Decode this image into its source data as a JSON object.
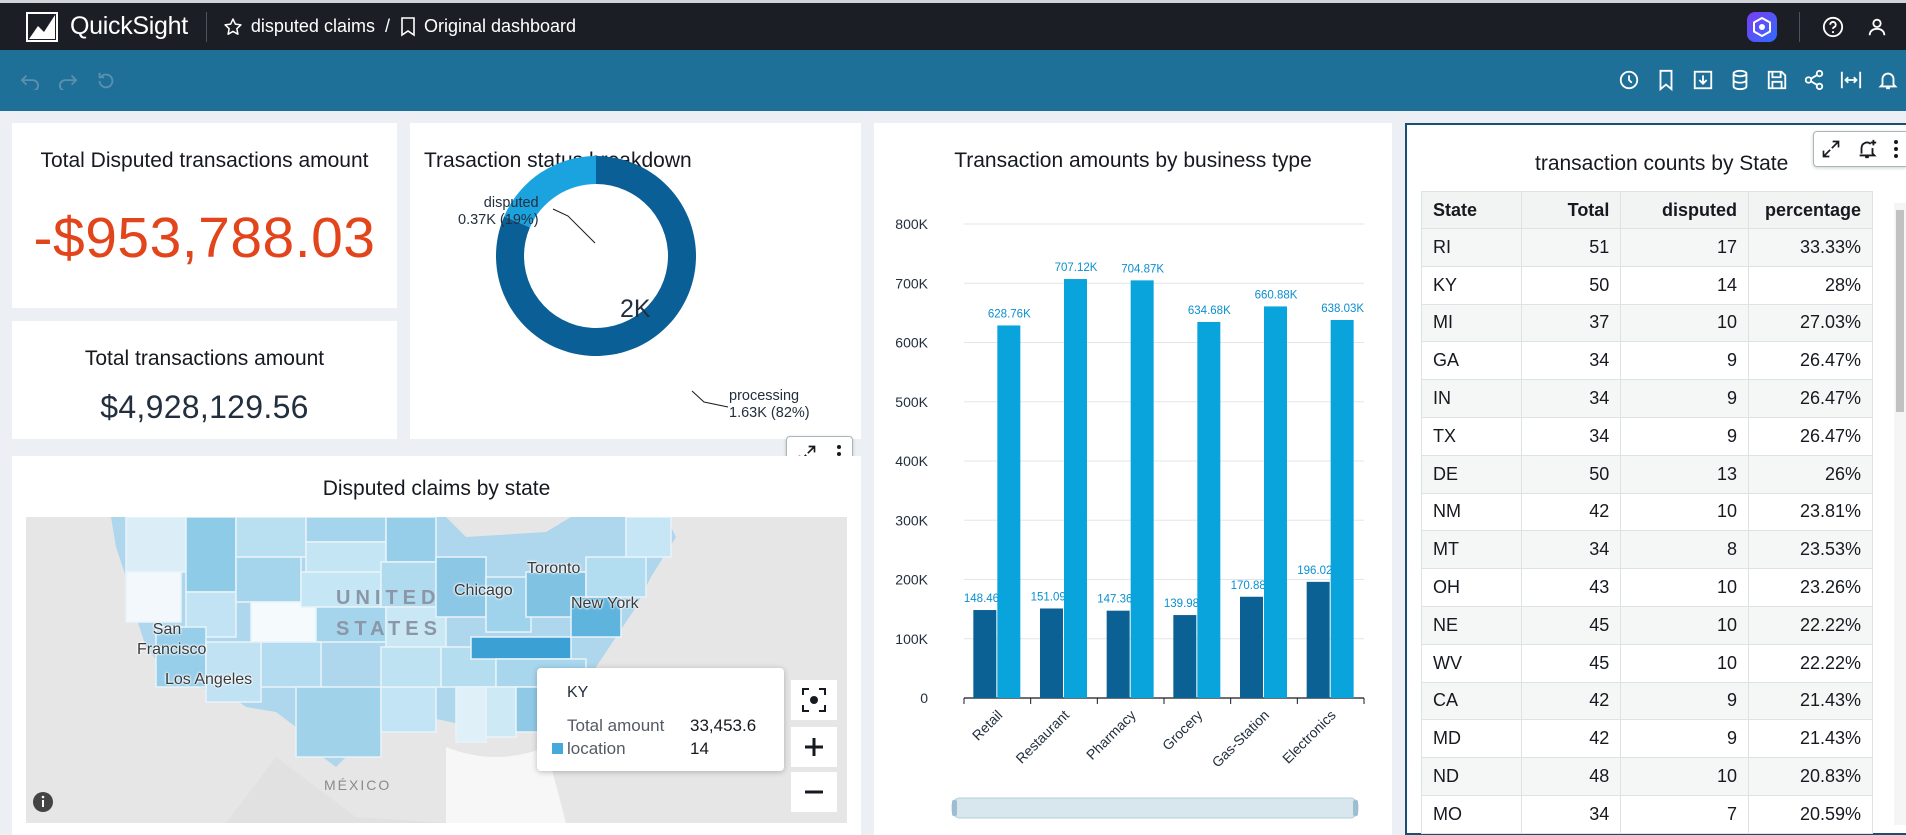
{
  "app": {
    "name": "QuickSight",
    "breadcrumb": {
      "analysis": "disputed claims",
      "separator": "/",
      "sheet": "Original dashboard"
    }
  },
  "toolbar": {
    "left_icons": [
      "undo-icon",
      "redo-icon",
      "reset-icon"
    ],
    "right_icons": [
      "schedule-icon",
      "bookmark-icon",
      "download-icon",
      "dataset-icon",
      "save-icon",
      "share-icon",
      "fit-width-icon",
      "alert-icon"
    ]
  },
  "kpi_disputed": {
    "title": "Total Disputed transactions amount",
    "value": "-$953,788.03"
  },
  "kpi_total": {
    "title": "Total transactions amount",
    "value": "$4,928,129.56"
  },
  "donut": {
    "title": "Trasaction status breakdown",
    "center": "2K",
    "slices": [
      {
        "name": "disputed",
        "label": "0.37K (19%)",
        "value": 0.37,
        "color": "#1ba3e0"
      },
      {
        "name": "processing",
        "label": "1.63K (82%)",
        "value": 1.63,
        "color": "#0a5f96"
      }
    ]
  },
  "map": {
    "title": "Disputed claims by state",
    "cities": [
      "Toronto",
      "Chicago",
      "New York",
      "San Francisco",
      "Los Angeles"
    ],
    "country_labels": [
      "UNITED",
      "STATES",
      "MÉXICO"
    ],
    "tooltip": {
      "state": "KY",
      "metric1_label": "Total amount",
      "metric1_value": "33,453.6",
      "metric2_label": "location",
      "metric2_value": "14"
    }
  },
  "chart_data": {
    "type": "bar",
    "title": "Transaction amounts by business type",
    "categories": [
      "Retail",
      "Restaurant",
      "Pharmacy",
      "Grocery",
      "Gas-Station",
      "Electronics"
    ],
    "series": [
      {
        "values": [
          148460,
          151090,
          147360,
          139980,
          170880,
          196020
        ],
        "labels": [
          "148.46K",
          "151.09K",
          "147.36K",
          "139.98K",
          "170.88K",
          "196.02K"
        ],
        "color": "#0b6194"
      },
      {
        "values": [
          628760,
          707120,
          704870,
          634680,
          660880,
          638030
        ],
        "labels": [
          "628.76K",
          "707.12K",
          "704.87K",
          "634.68K",
          "660.88K",
          "638.03K"
        ],
        "color": "#0aa4dc"
      }
    ],
    "ylim": [
      0,
      800000
    ],
    "yticks": [
      "0",
      "100K",
      "200K",
      "300K",
      "400K",
      "500K",
      "600K",
      "700K",
      "800K"
    ],
    "grid": true
  },
  "table": {
    "title": "transaction counts by State",
    "columns": [
      "State",
      "Total",
      "disputed",
      "percentage"
    ],
    "rows": [
      [
        "RI",
        "51",
        "17",
        "33.33%"
      ],
      [
        "KY",
        "50",
        "14",
        "28%"
      ],
      [
        "MI",
        "37",
        "10",
        "27.03%"
      ],
      [
        "GA",
        "34",
        "9",
        "26.47%"
      ],
      [
        "IN",
        "34",
        "9",
        "26.47%"
      ],
      [
        "TX",
        "34",
        "9",
        "26.47%"
      ],
      [
        "DE",
        "50",
        "13",
        "26%"
      ],
      [
        "NM",
        "42",
        "10",
        "23.81%"
      ],
      [
        "MT",
        "34",
        "8",
        "23.53%"
      ],
      [
        "OH",
        "43",
        "10",
        "23.26%"
      ],
      [
        "NE",
        "45",
        "10",
        "22.22%"
      ],
      [
        "WV",
        "45",
        "10",
        "22.22%"
      ],
      [
        "CA",
        "42",
        "9",
        "21.43%"
      ],
      [
        "MD",
        "42",
        "9",
        "21.43%"
      ],
      [
        "ND",
        "48",
        "10",
        "20.83%"
      ],
      [
        "MO",
        "34",
        "7",
        "20.59%"
      ]
    ]
  }
}
